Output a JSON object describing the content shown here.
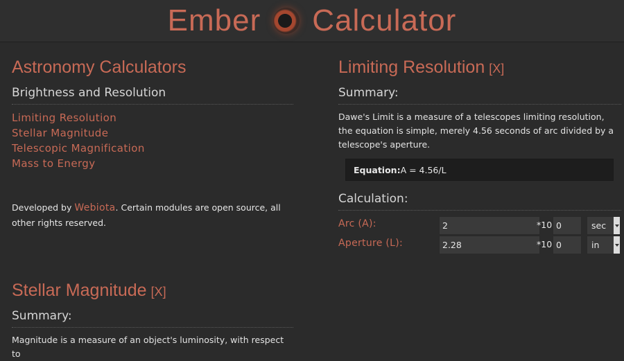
{
  "header": {
    "brand_left": "Ember",
    "brand_right": "Calculator",
    "logo_icon": "ember-orb-icon"
  },
  "left": {
    "title": "Astronomy Calculators",
    "section": "Brightness and Resolution",
    "links": [
      "Limiting Resolution",
      "Stellar Magnitude",
      "Telescopic Magnification",
      "Mass to Energy"
    ],
    "dev_prefix": "Developed by",
    "dev_link": "Webiota",
    "dev_suffix": ". Certain modules are open source, all other rights reserved."
  },
  "right": {
    "title": "Limiting Resolution",
    "close": "[X]",
    "summary_title": "Summary:",
    "summary_text": "Dawe's Limit is a measure of a telescopes limiting resolution, the equation is simple, merely 4.56 seconds of arc divided by a telescope's aperture.",
    "equation_label": "Equation:",
    "equation_value": " A = 4.56/L",
    "calc_title": "Calculation:",
    "rows": [
      {
        "label": "Arc (A):",
        "value": "2",
        "exp_label": "*10^",
        "exp_value": "0",
        "unit": "sec"
      },
      {
        "label": "Aperture (L):",
        "value": "2.28",
        "exp_label": "*10^",
        "exp_value": "0",
        "unit": "in"
      }
    ]
  },
  "lower_left": {
    "title": "Stellar Magnitude",
    "close": "[X]",
    "summary_title": "Summary:",
    "summary_text": "Magnitude is a measure of an object's luminosity, with respect to"
  },
  "colors": {
    "accent": "#c86a56",
    "background": "#2b2b2b",
    "header": "#2f2f2f",
    "equation_box": "#1d1d1d"
  }
}
